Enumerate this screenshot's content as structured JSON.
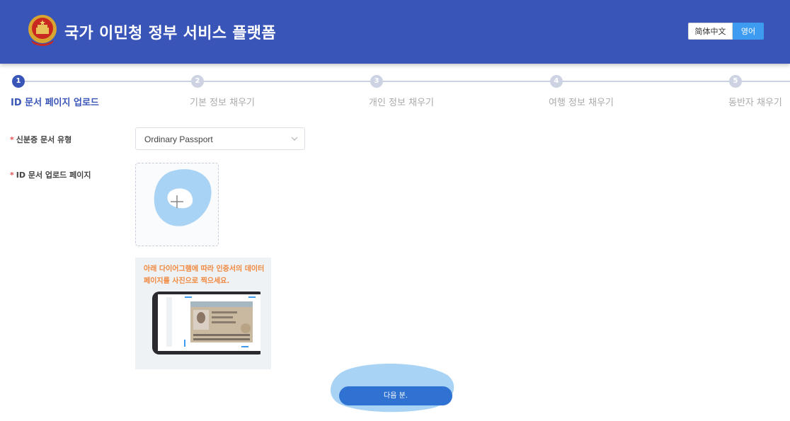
{
  "header": {
    "title": "국가 이민청 정부 서비스 플랫폼",
    "lang_zh": "简体中文",
    "lang_ko": "영어",
    "bg_color": "#3a55b8",
    "active_lang_color": "#3d9bf0"
  },
  "steps": [
    {
      "num": "1",
      "label": "ID 문서 페이지 업로드",
      "active": true
    },
    {
      "num": "2",
      "label": "기본 정보 채우기",
      "active": false
    },
    {
      "num": "3",
      "label": "개인 정보 채우기",
      "active": false
    },
    {
      "num": "4",
      "label": "여행 정보 채우기",
      "active": false
    },
    {
      "num": "5",
      "label": "동반자 채우기",
      "active": false
    }
  ],
  "form": {
    "doc_type_label": "신분증 문서 유형",
    "doc_type_value": "Ordinary Passport",
    "upload_label": "ID 문서 업로드 페이지",
    "required_mark": "*",
    "guide_text": "아래 다이어그램에 따라 인증서의 데이터 페이지를 사진으로 찍으세요."
  },
  "next_button": "다음 분.",
  "icons": [
    "emblem-icon",
    "chevron-down-icon",
    "plus-icon"
  ]
}
